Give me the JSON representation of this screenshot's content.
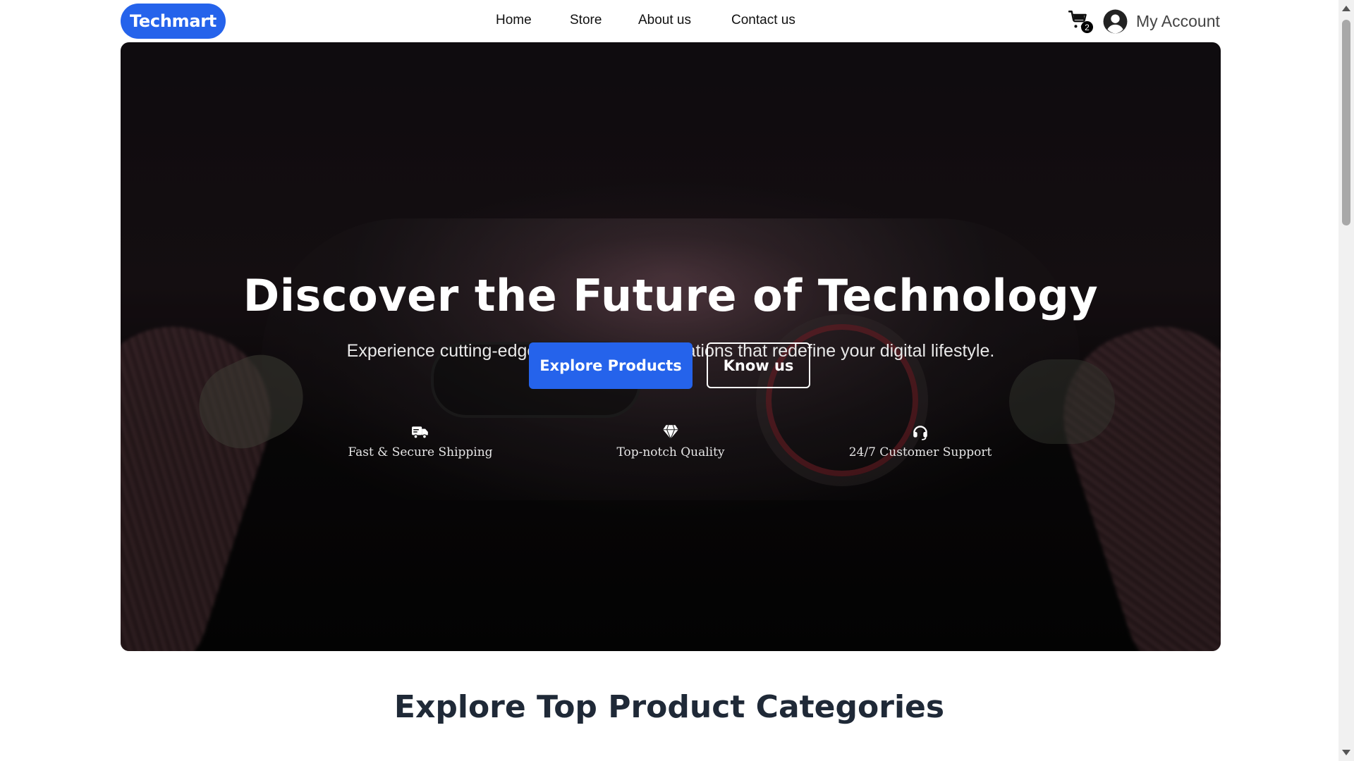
{
  "brand": {
    "name": "Techmart",
    "color": "#2563eb"
  },
  "nav": {
    "links": [
      {
        "label": "Home"
      },
      {
        "label": "Store"
      },
      {
        "label": "About us"
      },
      {
        "label": "Contact us"
      }
    ]
  },
  "cart": {
    "icon": "cart-icon",
    "count": "2"
  },
  "account": {
    "icon": "user-circle-icon",
    "label": "My Account"
  },
  "hero": {
    "title": "Discover the Future of Technology",
    "subtitle": "Experience cutting-edge gadgets and innovations that redefine your digital lifestyle.",
    "primary_button": "Explore Products",
    "secondary_button": "Know us",
    "features": [
      {
        "icon": "truck-icon",
        "label": "Fast & Secure Shipping"
      },
      {
        "icon": "diamond-icon",
        "label": "Top-notch Quality"
      },
      {
        "icon": "headset-icon",
        "label": "24/7 Customer Support"
      }
    ]
  },
  "section": {
    "title": "Explore Top Product Categories"
  }
}
